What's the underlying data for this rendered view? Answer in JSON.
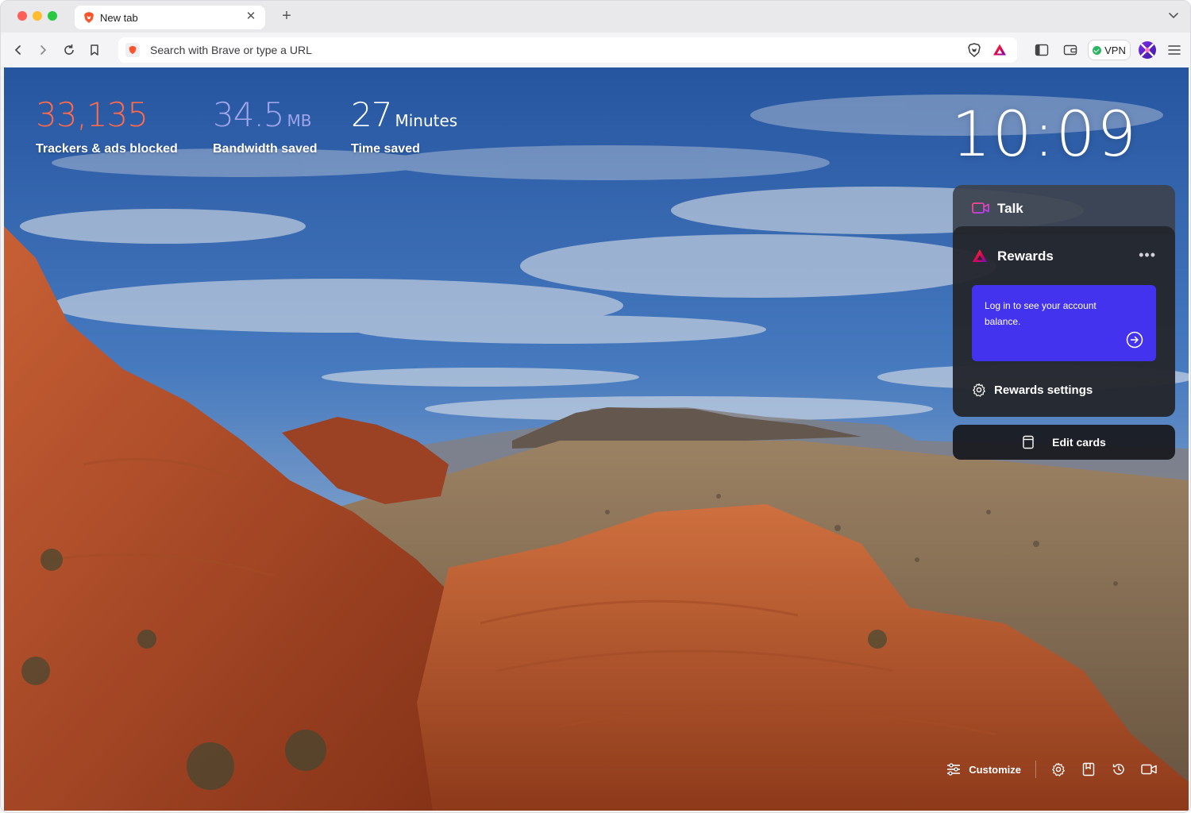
{
  "window": {
    "tab": {
      "title": "New tab",
      "favicon": "brave-lion-icon"
    }
  },
  "toolbar": {
    "url_placeholder": "Search with Brave or type a URL",
    "vpn_label": "VPN"
  },
  "stats": [
    {
      "value": "33,135",
      "unit": "",
      "label": "Trackers & ads blocked",
      "color": "#ff6a4b"
    },
    {
      "value": "34.5",
      "unit": "MB",
      "label": "Bandwidth saved",
      "color": "#a0a5eb"
    },
    {
      "value": "27",
      "unit": "Minutes",
      "label": "Time saved",
      "color": "#ffffff"
    }
  ],
  "clock": "10:09",
  "cards": {
    "talk_label": "Talk",
    "rewards_title": "Rewards",
    "login_text": "Log in to see your account balance.",
    "rewards_settings": "Rewards settings",
    "edit_cards": "Edit cards"
  },
  "bottom": {
    "customize": "Customize"
  },
  "colors": {
    "brave_orange": "#fb542b",
    "rewards_blue": "#4433ee",
    "card_dark": "#24272d"
  }
}
